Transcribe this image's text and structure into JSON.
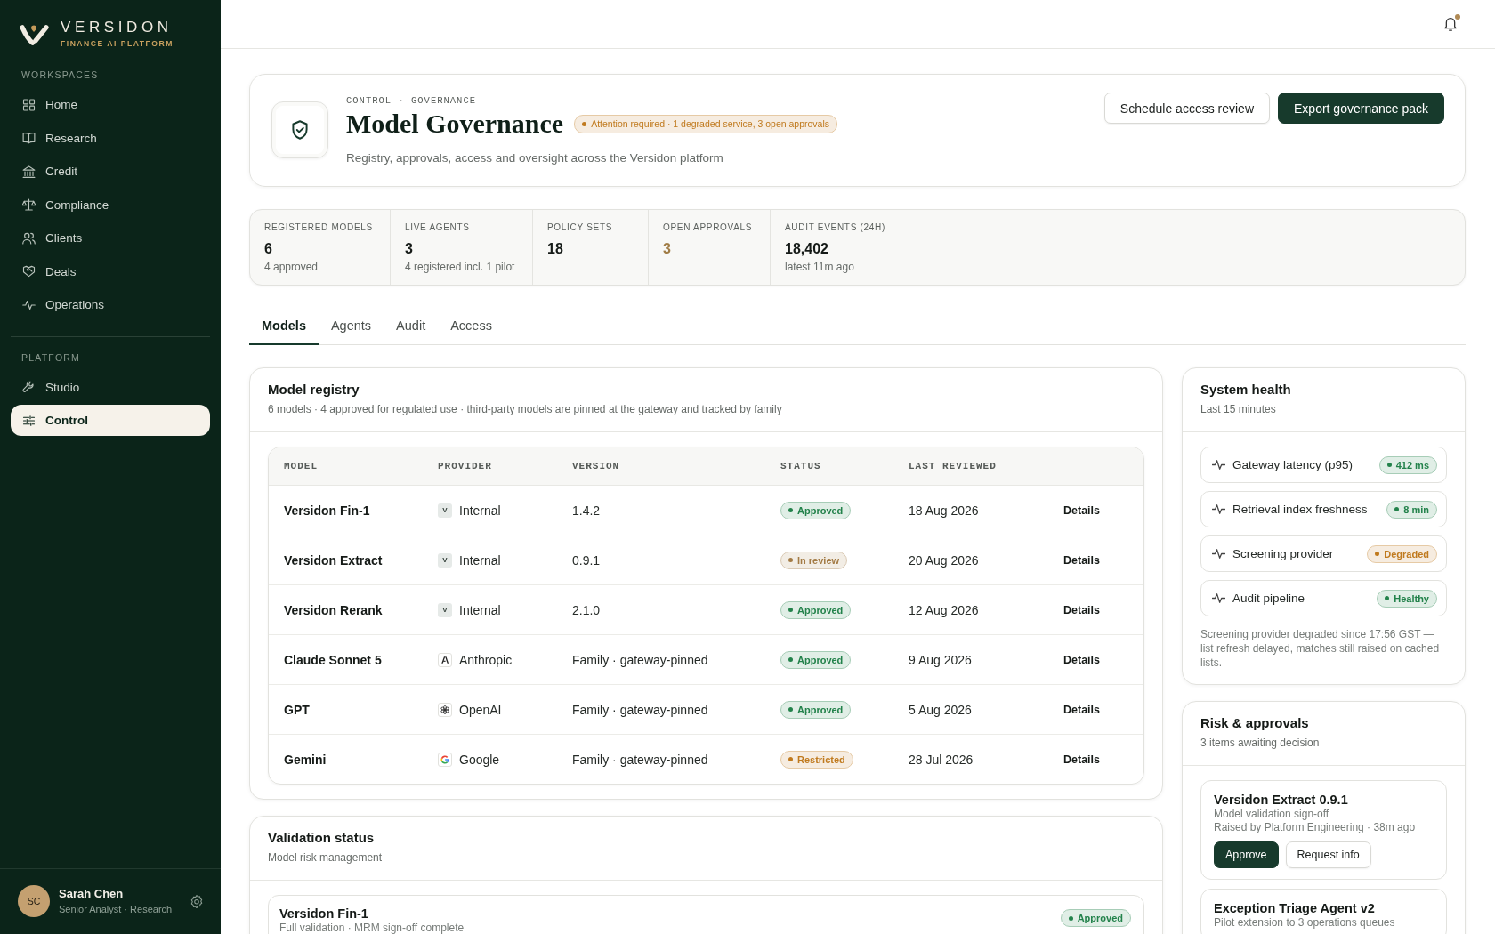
{
  "sidebar": {
    "brand": {
      "name": "VERSIDON",
      "tagline": "FINANCE AI PLATFORM"
    },
    "sections": [
      {
        "heading": "WORKSPACES",
        "items": [
          {
            "label": "Home",
            "selected": false
          },
          {
            "label": "Research",
            "selected": false
          },
          {
            "label": "Credit",
            "selected": false
          },
          {
            "label": "Compliance",
            "selected": false
          },
          {
            "label": "Clients",
            "selected": false
          },
          {
            "label": "Deals",
            "selected": false
          },
          {
            "label": "Operations",
            "selected": false
          }
        ]
      },
      {
        "heading": "PLATFORM",
        "items": [
          {
            "label": "Studio",
            "selected": false
          },
          {
            "label": "Control",
            "selected": true
          }
        ]
      }
    ],
    "user": {
      "initials": "SC",
      "name": "Sarah Chen",
      "role": "Senior Analyst · Research"
    }
  },
  "top_bar": {
    "notifications": {
      "unread": true
    }
  },
  "header": {
    "breadcrumb": "CONTROL · GOVERNANCE",
    "title": "Model Governance",
    "alert": {
      "label": "Attention required · 1 degraded service, 3 open approvals",
      "color": "#c07a1e"
    },
    "subtitle": "Registry, approvals, access and oversight across the Versidon platform",
    "actions": [
      {
        "label": "Schedule access review",
        "kind": "secondary"
      },
      {
        "label": "Export governance pack",
        "kind": "primary"
      }
    ]
  },
  "stats": [
    {
      "label": "REGISTERED MODELS",
      "value": "6",
      "note": "4 approved",
      "attention": false
    },
    {
      "label": "LIVE AGENTS",
      "value": "3",
      "note": "4 registered incl. 1 pilot",
      "attention": false
    },
    {
      "label": "POLICY SETS",
      "value": "18",
      "attention": false
    },
    {
      "label": "OPEN APPROVALS",
      "value": "3",
      "attention": true
    },
    {
      "label": "AUDIT EVENTS (24H)",
      "value": "18,402",
      "note": "latest 11m ago",
      "attention": false
    }
  ],
  "tabs": [
    {
      "label": "Models",
      "selected": true
    },
    {
      "label": "Agents",
      "selected": false
    },
    {
      "label": "Audit",
      "selected": false
    },
    {
      "label": "Access",
      "selected": false
    }
  ],
  "model_registry": {
    "title": "Model registry",
    "subtitle": "6 models · 4 approved for regulated use · third-party models are pinned at the gateway and tracked by family",
    "columns": [
      "MODEL",
      "PROVIDER",
      "VERSION",
      "STATUS",
      "LAST REVIEWED"
    ],
    "rows": [
      {
        "model": "Versidon Fin-1",
        "provider": {
          "name": "Internal",
          "mark": "V"
        },
        "version": "1.4.2",
        "status": {
          "label": "Approved",
          "color": "#23824b"
        },
        "last_reviewed": "18 Aug 2026",
        "action": "Details"
      },
      {
        "model": "Versidon Extract",
        "provider": {
          "name": "Internal",
          "mark": "V"
        },
        "version": "0.9.1",
        "status": {
          "label": "In review",
          "color": "#a37b45"
        },
        "last_reviewed": "20 Aug 2026",
        "action": "Details"
      },
      {
        "model": "Versidon Rerank",
        "provider": {
          "name": "Internal",
          "mark": "V"
        },
        "version": "2.1.0",
        "status": {
          "label": "Approved",
          "color": "#23824b"
        },
        "last_reviewed": "12 Aug 2026",
        "action": "Details"
      },
      {
        "model": "Claude Sonnet 5",
        "provider": {
          "name": "Anthropic"
        },
        "version": "Family · gateway-pinned",
        "status": {
          "label": "Approved",
          "color": "#23824b"
        },
        "last_reviewed": "9 Aug 2026",
        "action": "Details"
      },
      {
        "model": "GPT",
        "provider": {
          "name": "OpenAI"
        },
        "version": "Family · gateway-pinned",
        "status": {
          "label": "Approved",
          "color": "#23824b"
        },
        "last_reviewed": "5 Aug 2026",
        "action": "Details"
      },
      {
        "model": "Gemini",
        "provider": {
          "name": "Google"
        },
        "version": "Family · gateway-pinned",
        "status": {
          "label": "Restricted",
          "color": "#c07a1e"
        },
        "last_reviewed": "28 Jul 2026",
        "action": "Details"
      }
    ]
  },
  "validation_status": {
    "title": "Validation status",
    "subtitle": "Model risk management",
    "items": [
      {
        "name": "Versidon Fin-1",
        "detail": "Full validation · MRM sign-off complete",
        "status": {
          "label": "Approved",
          "color": "#23824b"
        }
      }
    ]
  },
  "system_health": {
    "title": "System health",
    "subtitle": "Last 15 minutes",
    "metrics": [
      {
        "label": "Gateway latency (p95)",
        "value": "412 ms",
        "color": "#23824b"
      },
      {
        "label": "Retrieval index freshness",
        "value": "8 min",
        "color": "#23824b"
      },
      {
        "label": "Screening provider",
        "value": "Degraded",
        "color": "#c07a1e"
      },
      {
        "label": "Audit pipeline",
        "value": "Healthy",
        "color": "#23824b"
      }
    ],
    "note": "Screening provider degraded since 17:56 GST — list refresh delayed, matches still raised on cached lists."
  },
  "risk_approvals": {
    "title": "Risk & approvals",
    "subtitle": "3 items awaiting decision",
    "items": [
      {
        "title": "Versidon Extract 0.9.1",
        "detail": "Model validation sign-off",
        "meta": "Raised by Platform Engineering · 38m ago",
        "actions": [
          {
            "label": "Approve",
            "kind": "primary"
          },
          {
            "label": "Request info",
            "kind": "secondary"
          }
        ]
      },
      {
        "title": "Exception Triage Agent v2",
        "detail": "Pilot extension to 3 operations queues"
      }
    ]
  }
}
